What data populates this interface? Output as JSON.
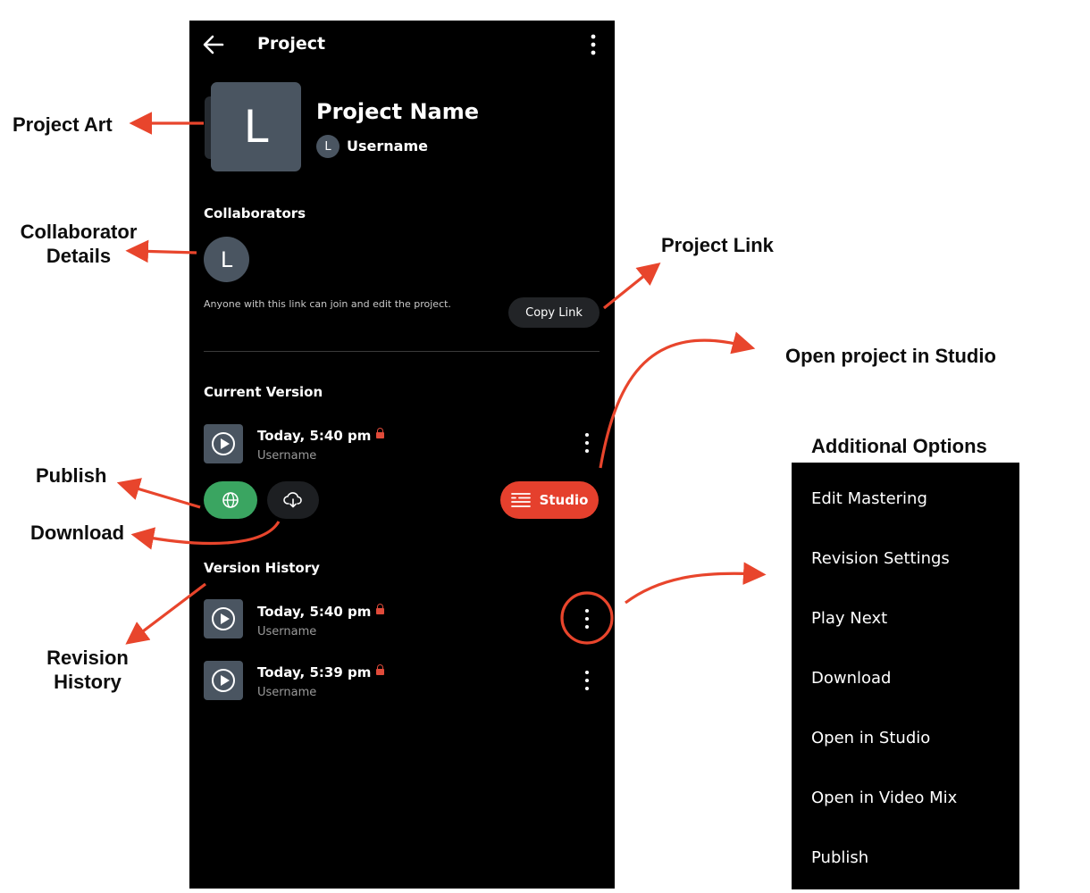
{
  "annotations": {
    "project_art": "Project Art",
    "collaborator_details_1": "Collaborator",
    "collaborator_details_2": "Details",
    "project_link": "Project Link",
    "open_in_studio": "Open project in Studio",
    "additional_options": "Additional Options",
    "publish": "Publish",
    "download": "Download",
    "revision_history_1": "Revision",
    "revision_history_2": "History"
  },
  "topbar": {
    "title": "Project",
    "back_icon": "arrow-left-icon",
    "menu_icon": "more-vertical-icon"
  },
  "project": {
    "art_letter": "L",
    "name": "Project Name",
    "owner_avatar": "L",
    "owner_name": "Username"
  },
  "collaborators": {
    "title": "Collaborators",
    "avatar_letter": "L",
    "invite_text": "Anyone with this link can join and edit the project.",
    "copy_link_label": "Copy Link"
  },
  "current_version": {
    "title": "Current Version",
    "time": "Today, 5:40 pm",
    "user": "Username",
    "studio_label": "Studio"
  },
  "version_history": {
    "title": "Version History",
    "items": [
      {
        "time": "Today, 5:40 pm",
        "user": "Username"
      },
      {
        "time": "Today, 5:39 pm",
        "user": "Username"
      }
    ]
  },
  "options_menu": {
    "items": [
      "Edit Mastering",
      "Revision Settings",
      "Play Next",
      "Download",
      "Open in Studio",
      "Open in Video Mix",
      "Publish"
    ]
  },
  "colors": {
    "accent_red": "#e5402d",
    "publish_green": "#3aa561",
    "annotation_arrow": "#e8452c",
    "avatar_gray": "#4a5561"
  }
}
